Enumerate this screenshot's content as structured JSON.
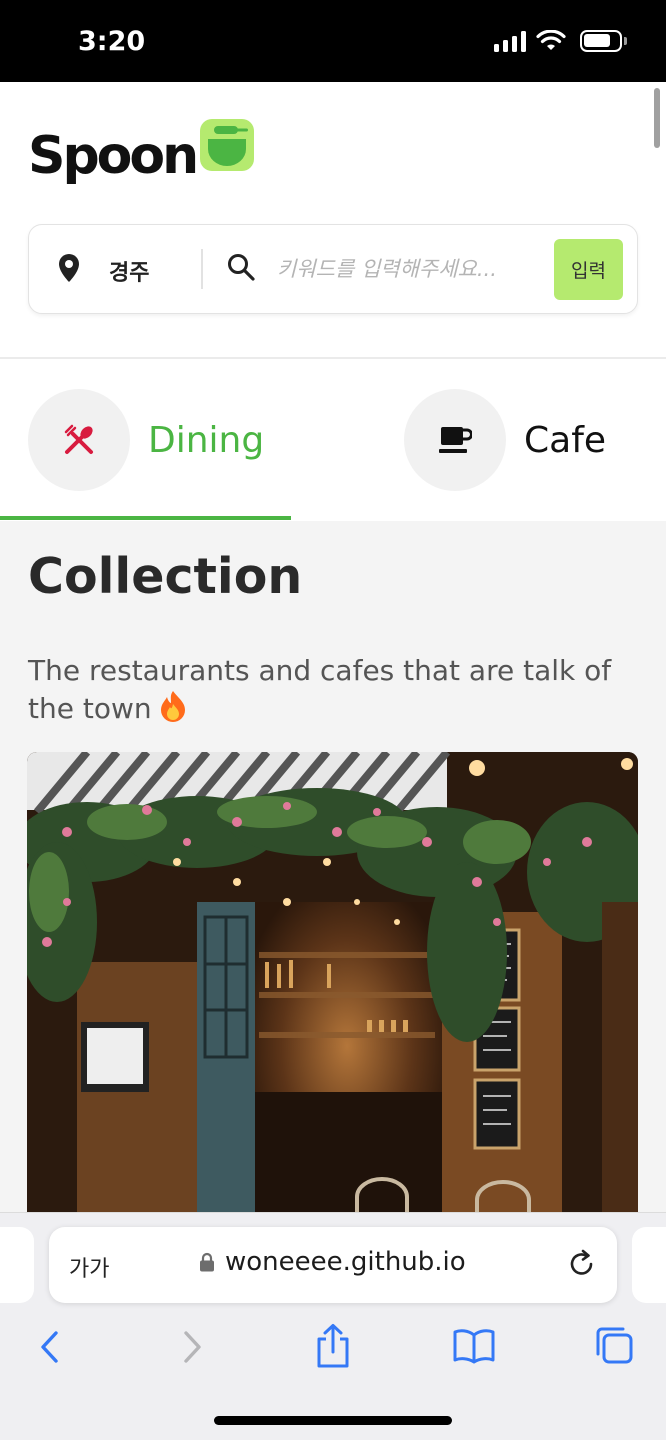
{
  "status_bar": {
    "time": "3:20"
  },
  "header": {
    "logo_text": "Spoon",
    "search": {
      "location": "경주",
      "placeholder": "키워드를 입력해주세요...",
      "submit_label": "입력"
    }
  },
  "tabs": [
    {
      "label": "Dining",
      "icon": "fork-knife-icon",
      "active": true
    },
    {
      "label": "Cafe",
      "icon": "coffee-cup-icon",
      "active": false
    }
  ],
  "collection": {
    "title": "Collection",
    "subtitle": "The restaurants and cafes that are talk of the town"
  },
  "browser": {
    "aa_label": "가가",
    "url": "woneeee.github.io"
  },
  "colors": {
    "accent_green": "#4bb543",
    "button_green": "#b5ea6f",
    "link_blue": "#3478f6",
    "dining_icon_red": "#d81b3f"
  }
}
